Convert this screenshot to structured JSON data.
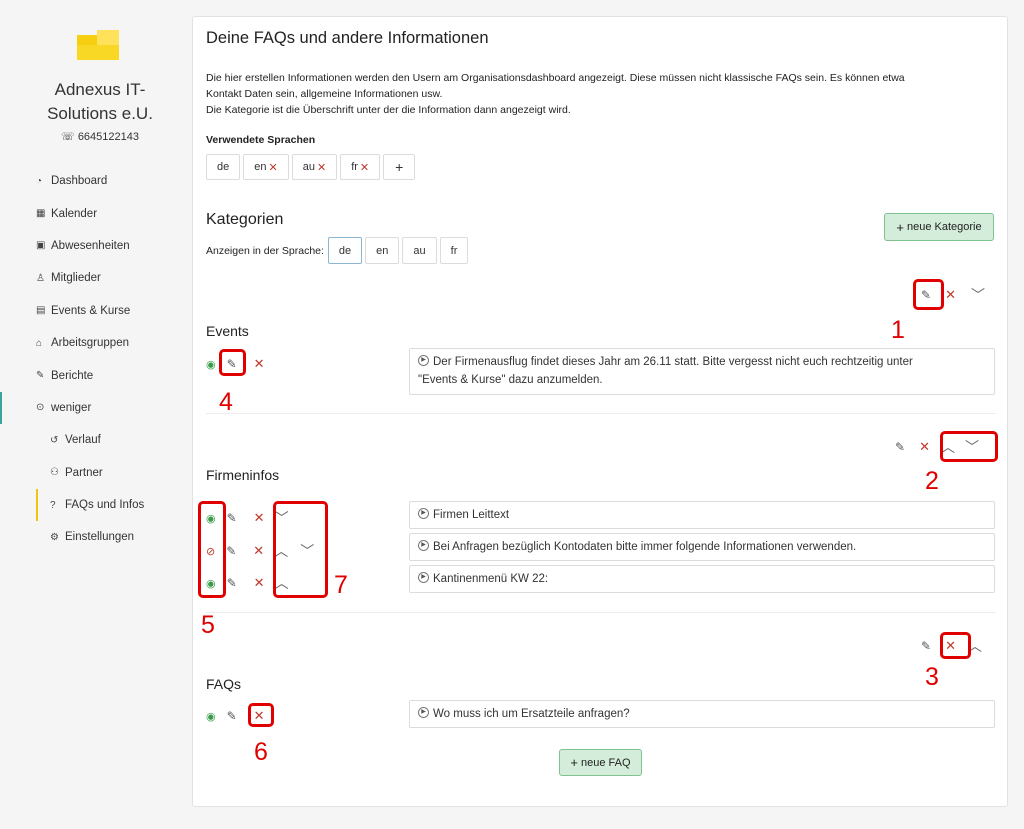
{
  "org": {
    "name_line1": "Adnexus IT-",
    "name_line2": "Solutions e.U.",
    "phone": "6645122143"
  },
  "nav": [
    {
      "label": "Dashboard",
      "icon": "dashboard-icon"
    },
    {
      "label": "Kalender",
      "icon": "calendar-icon"
    },
    {
      "label": "Abwesenheiten",
      "icon": "calendar-check-icon"
    },
    {
      "label": "Mitglieder",
      "icon": "user-icon"
    },
    {
      "label": "Events & Kurse",
      "icon": "event-icon"
    },
    {
      "label": "Arbeitsgruppen",
      "icon": "institution-icon"
    },
    {
      "label": "Berichte",
      "icon": "paperclip-icon"
    },
    {
      "label": "weniger",
      "icon": "chevron-up-circle-icon"
    },
    {
      "label": "Verlauf",
      "icon": "history-icon"
    },
    {
      "label": "Partner",
      "icon": "people-icon"
    },
    {
      "label": "FAQs und Infos",
      "icon": "question-icon"
    },
    {
      "label": "Einstellungen",
      "icon": "gears-icon"
    }
  ],
  "page": {
    "title": "Deine FAQs und andere Informationen",
    "desc_line1": "Die hier erstellen Informationen werden den Usern am Organisationsdashboard angezeigt. Diese müssen nicht klassische FAQs sein. Es können etwa",
    "desc_line2": "Kontakt Daten sein, allgemeine Informationen usw.",
    "desc_line3": "Die Kategorie ist die Überschrift unter der die Information dann angezeigt wird.",
    "languages_label": "Verwendete Sprachen",
    "languages": [
      "de",
      "en",
      "au",
      "fr"
    ],
    "add_symbol": "+"
  },
  "categories_section": {
    "title": "Kategorien",
    "show_in_language_label": "Anzeigen in der Sprache:",
    "languages": [
      "de",
      "en",
      "au",
      "fr"
    ],
    "selected_language": "de",
    "new_category_label": "neue Kategorie",
    "new_faq_label": "neue FAQ"
  },
  "categories": [
    {
      "title": "Events",
      "items": [
        {
          "text_line1": "Der Firmenausflug findet dieses Jahr am 26.11 statt. Bitte vergesst nicht euch rechtzeitig unter",
          "text_line2": "\"Events & Kurse\" dazu anzumelden.",
          "visible": true
        }
      ]
    },
    {
      "title": "Firmeninfos",
      "items": [
        {
          "text": "Firmen Leittext",
          "visible": true
        },
        {
          "text": "Bei Anfragen bezüglich Kontodaten bitte immer folgende Informationen verwenden.",
          "visible": false
        },
        {
          "text": "Kantinenmenü KW 22:",
          "visible": true
        }
      ]
    },
    {
      "title": "FAQs",
      "items": [
        {
          "text": "Wo muss ich um Ersatzteile anfragen?",
          "visible": true
        }
      ]
    }
  ],
  "annotations": [
    "1",
    "2",
    "3",
    "4",
    "5",
    "6",
    "7"
  ],
  "colors": {
    "accent_teal": "#3aa49a",
    "accent_yellow": "#f1c40f",
    "delete_red": "#c0392b",
    "visible_green": "#3a9c4a",
    "button_green": "#d4edda",
    "annotation_red": "#e00000"
  }
}
